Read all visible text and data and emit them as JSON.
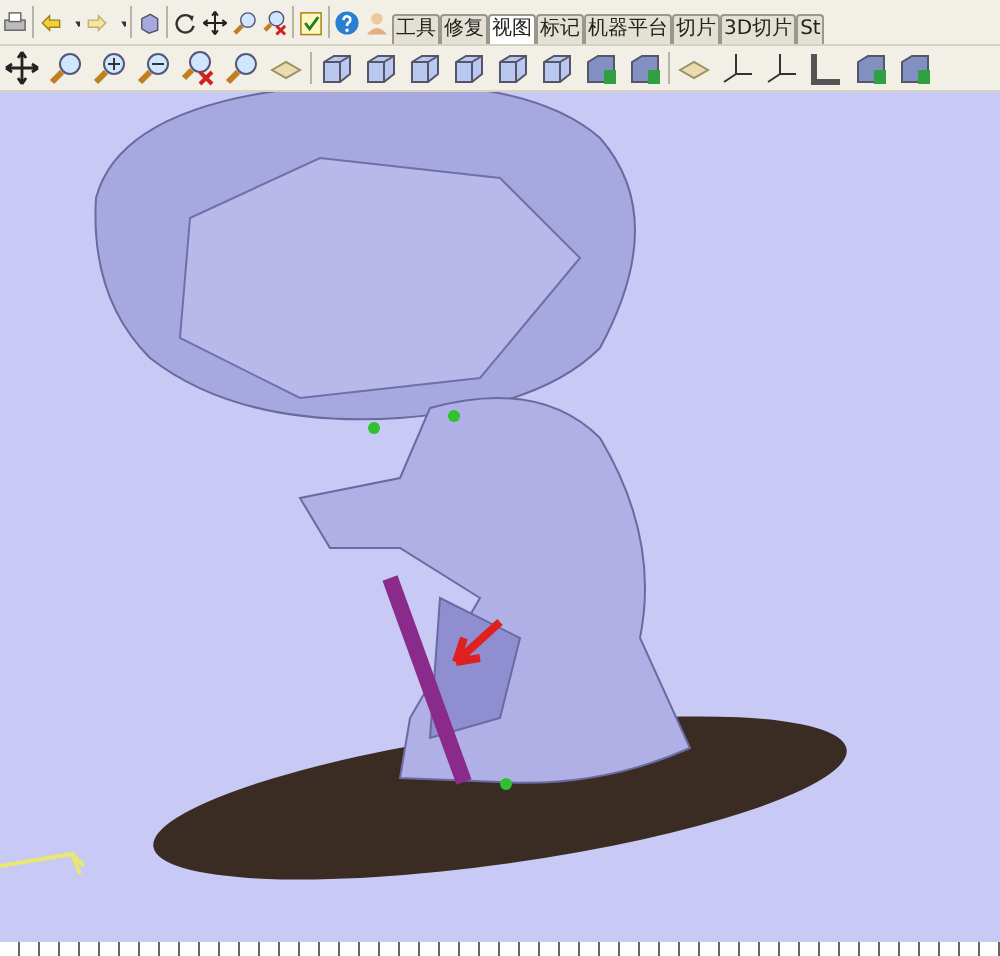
{
  "tabs": [
    {
      "label": "工具",
      "selected": false
    },
    {
      "label": "修复",
      "selected": false
    },
    {
      "label": "视图",
      "selected": true
    },
    {
      "label": "标记",
      "selected": false
    },
    {
      "label": "机器平台",
      "selected": false
    },
    {
      "label": "切片",
      "selected": false
    },
    {
      "label": "3D切片",
      "selected": false
    },
    {
      "label": "St",
      "selected": false
    }
  ]
}
